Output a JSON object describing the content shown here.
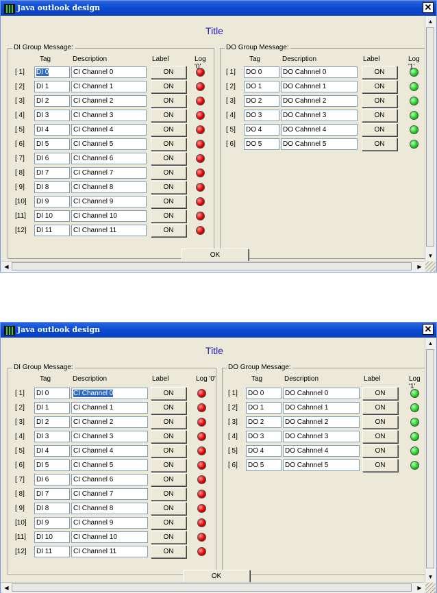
{
  "window": {
    "title": "Java outlook design",
    "close_label": "✕"
  },
  "panel_title": "Title",
  "di_group": {
    "legend": "DI Group Message:",
    "headers": {
      "tag": "Tag",
      "description": "Description",
      "label": "Label",
      "log": "Log '0'"
    },
    "rows": [
      {
        "index": "[ 1]",
        "tag": "DI 0",
        "description": "CI Channel 0",
        "button": "ON"
      },
      {
        "index": "[ 2]",
        "tag": "DI 1",
        "description": "CI Channel 1",
        "button": "ON"
      },
      {
        "index": "[ 3]",
        "tag": "DI 2",
        "description": "CI Channel 2",
        "button": "ON"
      },
      {
        "index": "[ 4]",
        "tag": "DI 3",
        "description": "CI Channel 3",
        "button": "ON"
      },
      {
        "index": "[ 5]",
        "tag": "DI 4",
        "description": "CI Channel 4",
        "button": "ON"
      },
      {
        "index": "[ 6]",
        "tag": "DI 5",
        "description": "CI Channel 5",
        "button": "ON"
      },
      {
        "index": "[ 7]",
        "tag": "DI 6",
        "description": "CI Channel 6",
        "button": "ON"
      },
      {
        "index": "[ 8]",
        "tag": "DI 7",
        "description": "CI Channel 7",
        "button": "ON"
      },
      {
        "index": "[ 9]",
        "tag": "DI 8",
        "description": "CI Channel 8",
        "button": "ON"
      },
      {
        "index": "[10]",
        "tag": "DI 9",
        "description": "CI Channel 9",
        "button": "ON"
      },
      {
        "index": "[11]",
        "tag": "DI 10",
        "description": "CI Channel 10",
        "button": "ON"
      },
      {
        "index": "[12]",
        "tag": "DI 11",
        "description": "CI Channel 11",
        "button": "ON"
      }
    ]
  },
  "do_group": {
    "legend": "DO Group Message:",
    "headers": {
      "tag": "Tag",
      "description": "Description",
      "label": "Label",
      "log": "Log '1'"
    },
    "rows": [
      {
        "index": "[ 1]",
        "tag": "DO 0",
        "description": "DO Cahnnel 0",
        "button": "ON"
      },
      {
        "index": "[ 2]",
        "tag": "DO 1",
        "description": "DO Cahnnel 1",
        "button": "ON"
      },
      {
        "index": "[ 3]",
        "tag": "DO 2",
        "description": "DO Cahnnel 2",
        "button": "ON"
      },
      {
        "index": "[ 4]",
        "tag": "DO 3",
        "description": "DO Cahnnel 3",
        "button": "ON"
      },
      {
        "index": "[ 5]",
        "tag": "DO 4",
        "description": "DO Cahnnel 4",
        "button": "ON"
      },
      {
        "index": "[ 6]",
        "tag": "DO 5",
        "description": "DO Cahnnel 5",
        "button": "ON"
      }
    ]
  },
  "ok_label": "OK",
  "colors": {
    "titlebar": "#0a4ad0",
    "title_text": "#1a1ab8",
    "led_off": "#e00000",
    "led_on": "#22d022",
    "selection": "#316ac5"
  },
  "icons": [
    "app-icon",
    "close-icon",
    "red-led-icon",
    "green-led-icon",
    "scroll-arrow-icon"
  ]
}
